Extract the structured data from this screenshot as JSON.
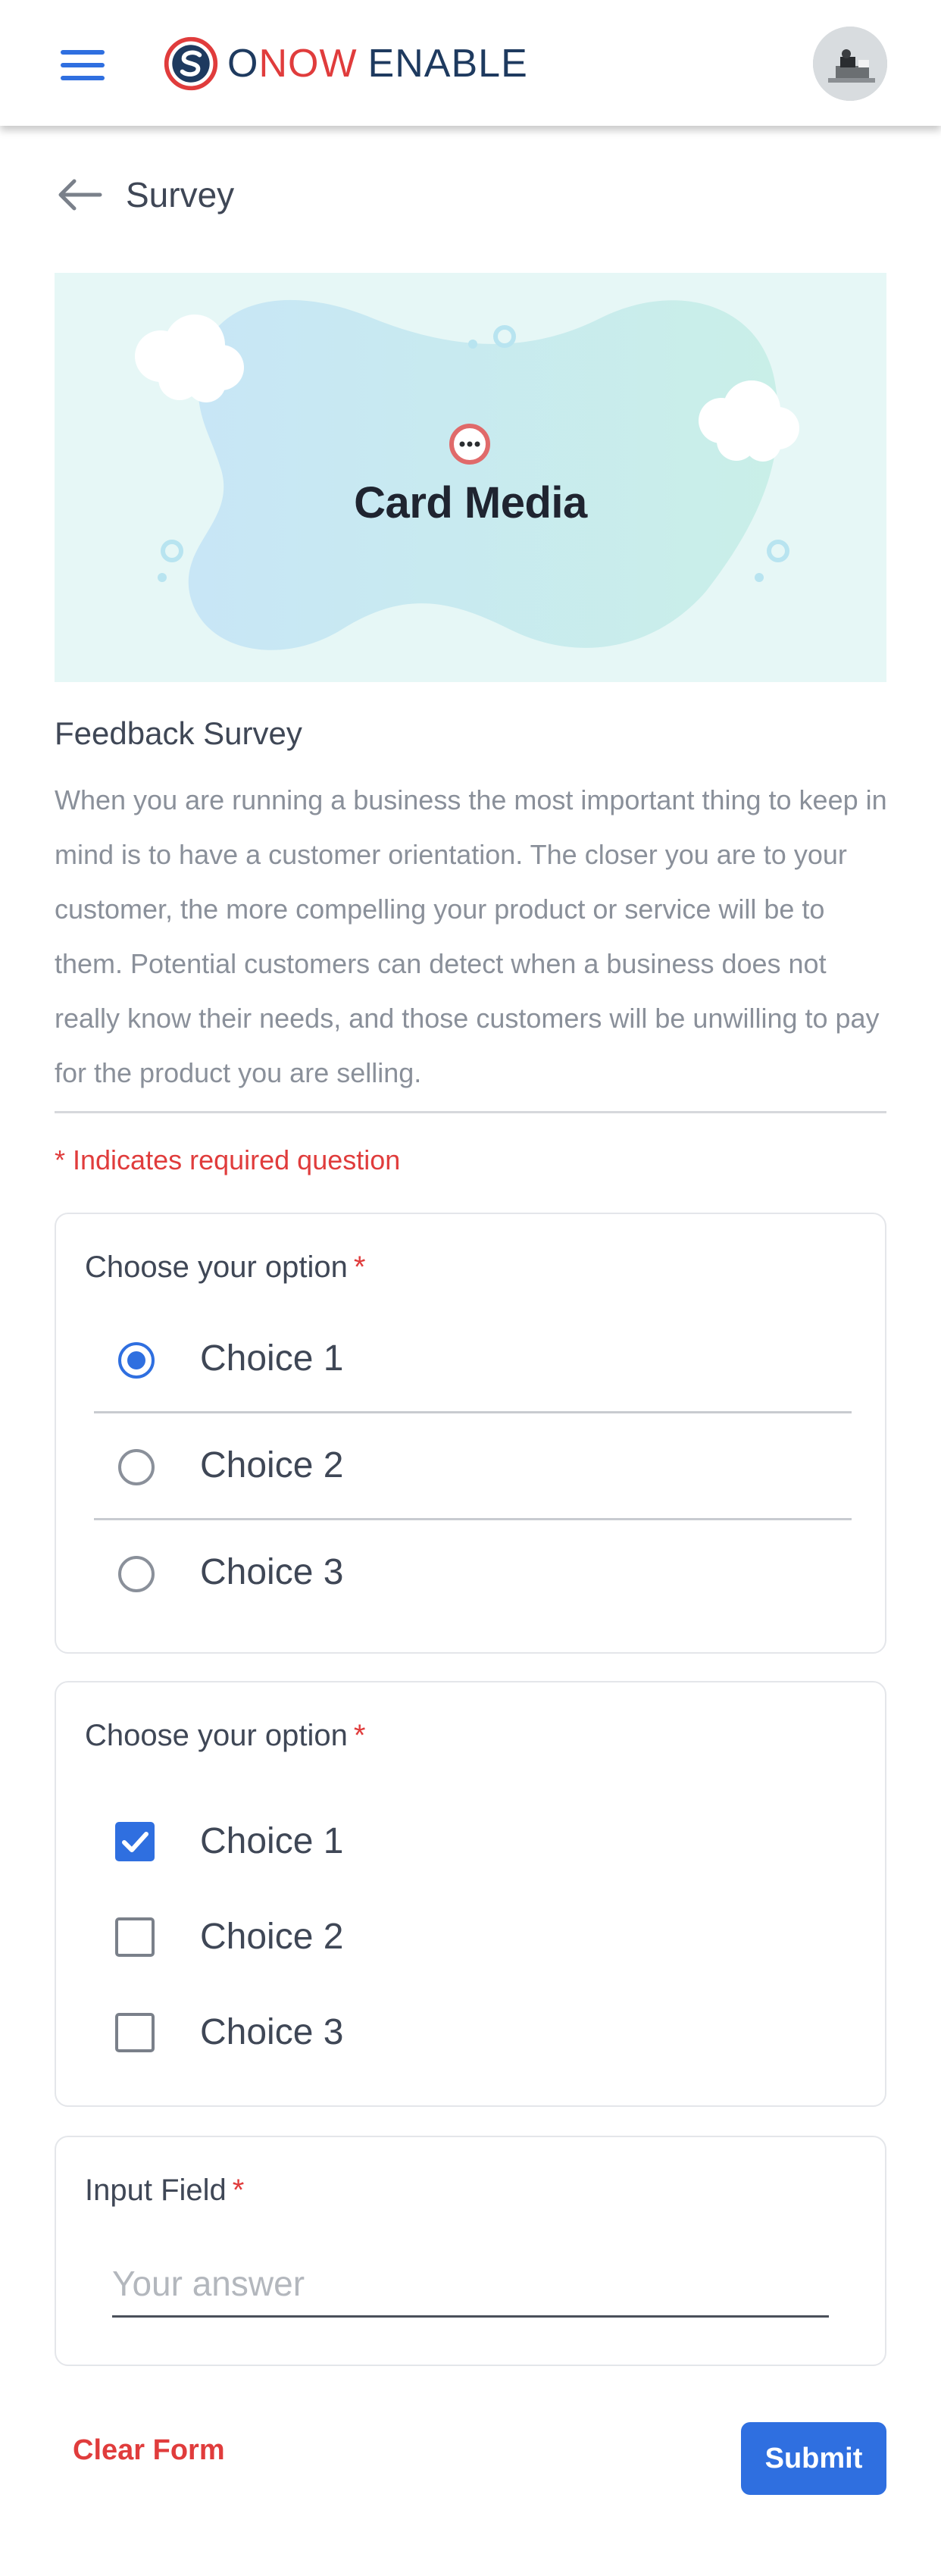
{
  "header": {
    "logo_prefix": "O",
    "logo_now": "NOW",
    "logo_suffix": "ENABLE",
    "menu_icon": "hamburger-menu-icon",
    "avatar": "user-avatar"
  },
  "page": {
    "title": "Survey",
    "back_icon": "arrow-left-icon"
  },
  "media": {
    "label": "Card Media",
    "icon": "chat-bubble-icon"
  },
  "survey": {
    "title": "Feedback Survey",
    "description": "When you are running a business the most important thing to keep in mind is to have a customer orientation. The closer you are to your customer, the more compelling your product or service will be to them. Potential customers can detect when a business does not really know their needs, and those customers will be unwilling to pay for the product you are selling.",
    "required_note": "* Indicates required question"
  },
  "questions": [
    {
      "label": "Choose your option",
      "required_mark": "*",
      "type": "radio",
      "options": [
        "Choice 1",
        "Choice 2",
        "Choice 3"
      ],
      "selected": "Choice 1"
    },
    {
      "label": "Choose your option",
      "required_mark": "*",
      "type": "checkbox",
      "options": [
        "Choice 1",
        "Choice 2",
        "Choice 3"
      ],
      "checked": [
        "Choice 1"
      ]
    },
    {
      "label": "Input Field",
      "required_mark": "*",
      "type": "text",
      "value": "",
      "placeholder": "Your answer"
    }
  ],
  "actions": {
    "clear_label": "Clear Form",
    "submit_label": "Submit"
  },
  "colors": {
    "accent": "#2f6fe0",
    "required": "#e03c3c",
    "brand_dark": "#1e3a5f"
  }
}
